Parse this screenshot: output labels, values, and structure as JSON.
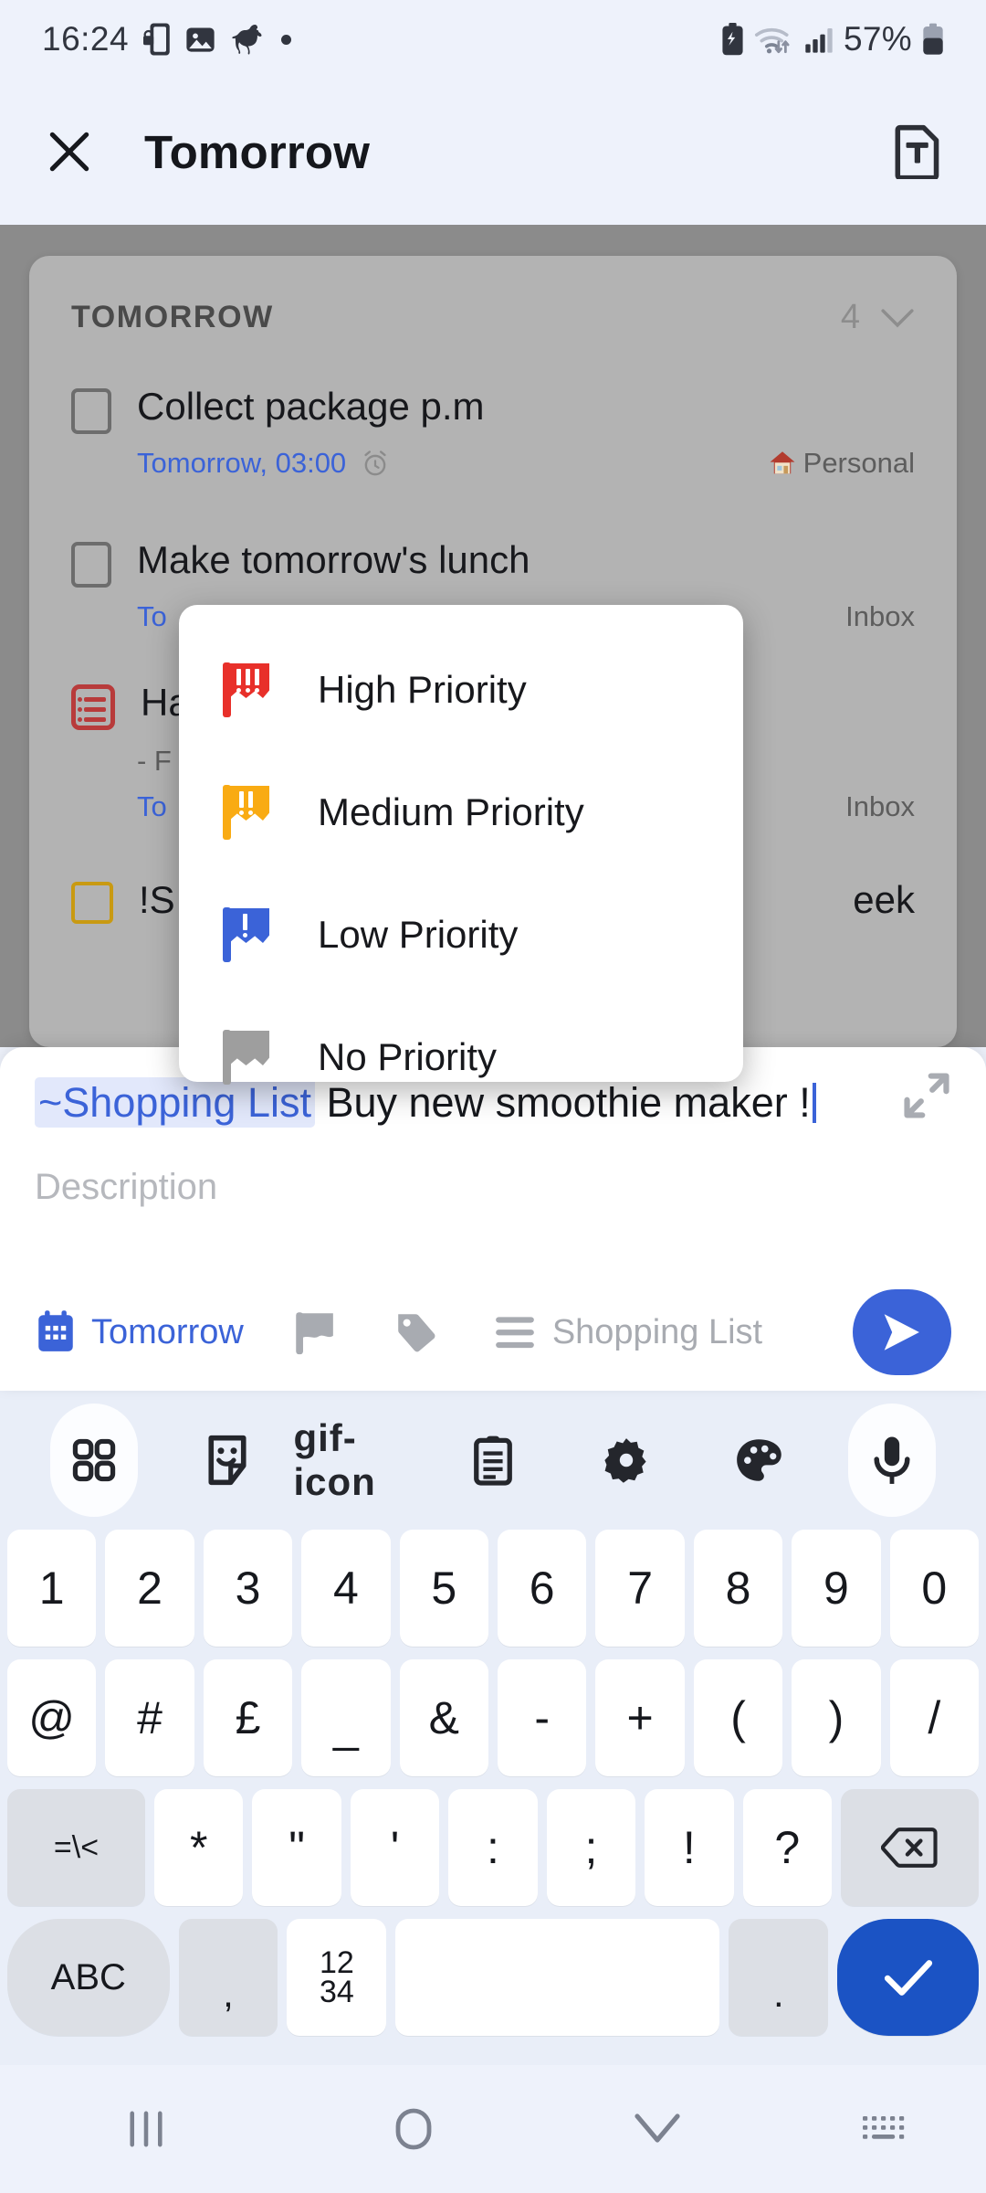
{
  "status_bar": {
    "time": "16:24",
    "battery_percent": "57%",
    "left_icons": [
      "phone-lock-icon",
      "image-icon",
      "horse-icon",
      "dot-icon"
    ],
    "right_icons": [
      "battery-saver-icon",
      "wifi-icon",
      "signal-icon",
      "battery-icon"
    ]
  },
  "app_bar": {
    "close_icon": "close-icon",
    "title": "Tomorrow",
    "template_icon": "text-template-icon"
  },
  "task_list": {
    "section_title": "TOMORROW",
    "count": "4",
    "collapse_icon": "chevron-down-icon",
    "tasks": [
      {
        "title": "Collect package p.m",
        "when": "Tomorrow, 03:00",
        "reminder_icon": "alarm-icon",
        "list": "Personal",
        "list_icon": "house-icon",
        "checkbox": "checkbox-unchecked"
      },
      {
        "title": "Make tomorrow's lunch",
        "when": "To",
        "list": "Inbox",
        "checkbox": "checkbox-unchecked"
      },
      {
        "title": "Ha",
        "note": "- F",
        "when": "To",
        "list": "Inbox",
        "checkbox": "subtask-list-icon"
      },
      {
        "title": "!S",
        "title_tail": "eek",
        "checkbox": "checkbox-amber"
      }
    ]
  },
  "priority_popup": {
    "items": [
      {
        "label": "High Priority",
        "icon": "flag-icon",
        "color": "#e8302a",
        "bangs": 3
      },
      {
        "label": "Medium Priority",
        "icon": "flag-icon",
        "color": "#f9ab13",
        "bangs": 2
      },
      {
        "label": "Low Priority",
        "icon": "flag-icon",
        "color": "#3b63d8",
        "bangs": 1
      },
      {
        "label": "No Priority",
        "icon": "flag-icon",
        "color": "#9e9e9e",
        "bangs": 0
      }
    ]
  },
  "add_task_sheet": {
    "title_chip": "~Shopping List",
    "title_text": " Buy new smoothie maker !",
    "description_placeholder": "Description",
    "expand_icon": "expand-icon",
    "bar": {
      "date_icon": "calendar-icon",
      "date_label": "Tomorrow",
      "priority_icon": "flag-icon",
      "tag_icon": "tag-icon",
      "list_icon": "list-lines-icon",
      "list_label": "Shopping List",
      "send_icon": "send-icon"
    }
  },
  "keyboard": {
    "toolbar": [
      "grid-icon",
      "sticker-icon",
      "gif-icon",
      "clipboard-icon",
      "gear-icon",
      "palette-icon",
      "microphone-icon"
    ],
    "row1": [
      "1",
      "2",
      "3",
      "4",
      "5",
      "6",
      "7",
      "8",
      "9",
      "0"
    ],
    "row2": [
      "@",
      "#",
      "£",
      "_",
      "&",
      "-",
      "+",
      "(",
      ")",
      "/"
    ],
    "row3": [
      "=\\<",
      "*",
      "\"",
      "'",
      ":",
      ";",
      "!",
      "?",
      "backspace-icon"
    ],
    "row4": {
      "abc": "ABC",
      "comma": ",",
      "numbers_top": "12",
      "numbers_bottom": "34",
      "space": "",
      "period": ".",
      "enter": "check-icon"
    }
  },
  "nav_bar": {
    "recents_icon": "recents-icon",
    "home_icon": "home-icon",
    "back_icon": "chevron-down-icon",
    "keyboard_icon": "keyboard-switch-icon"
  }
}
